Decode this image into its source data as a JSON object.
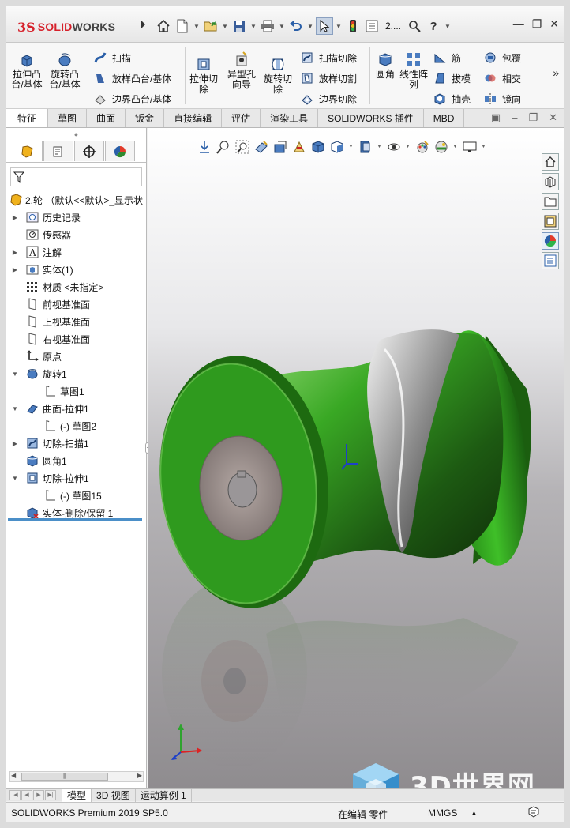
{
  "app": {
    "brand_prefix": "3S",
    "brand_solid": "SOLID",
    "brand_works": "WORKS",
    "document_short": "2...."
  },
  "ribbon": {
    "large": [
      {
        "label": "拉伸凸\n台/基体"
      },
      {
        "label": "旋转凸\n台/基体"
      },
      {
        "label": "拉伸切\n除"
      },
      {
        "label": "异型孔\n向导"
      },
      {
        "label": "旋转切\n除"
      },
      {
        "label": "圆角"
      },
      {
        "label": "线性阵\n列"
      }
    ],
    "small": {
      "sweep": "扫描",
      "loft": "放样凸台/基体",
      "boundary": "边界凸台/基体",
      "sweep_cut": "扫描切除",
      "loft_cut": "放样切割",
      "boundary_cut": "边界切除",
      "rib": "筋",
      "draft": "拔模",
      "shell": "抽壳",
      "wrap": "包覆",
      "intersect": "相交",
      "mirror": "镜向"
    }
  },
  "tabs": [
    "特征",
    "草图",
    "曲面",
    "钣金",
    "直接编辑",
    "评估",
    "渲染工具",
    "SOLIDWORKS 插件",
    "MBD"
  ],
  "tree": {
    "root": "2.轮 （默认<<默认>_显示状",
    "items": [
      {
        "label": "历史记录"
      },
      {
        "label": "传感器"
      },
      {
        "label": "注解"
      },
      {
        "label": "实体(1)"
      },
      {
        "label": "材质 <未指定>"
      },
      {
        "label": "前视基准面"
      },
      {
        "label": "上视基准面"
      },
      {
        "label": "右视基准面"
      },
      {
        "label": "原点"
      },
      {
        "label": "旋转1"
      },
      {
        "label": "草图1"
      },
      {
        "label": "曲面-拉伸1"
      },
      {
        "label": "(-) 草图2"
      },
      {
        "label": "切除-扫描1"
      },
      {
        "label": "圆角1"
      },
      {
        "label": "切除-拉伸1"
      },
      {
        "label": "(-) 草图15"
      },
      {
        "label": "实体-删除/保留 1"
      }
    ]
  },
  "bottom_tabs": [
    "模型",
    "3D 视图",
    "运动算例 1"
  ],
  "status": {
    "product": "SOLIDWORKS Premium 2019 SP5.0",
    "editing": "在编辑 零件",
    "units": "MMGS"
  },
  "watermark": {
    "text": "3D世界网"
  },
  "colors": {
    "brand_red": "#d6202a",
    "model_green": "#2f9a1e",
    "selection_blue": "#4b8fc8"
  }
}
